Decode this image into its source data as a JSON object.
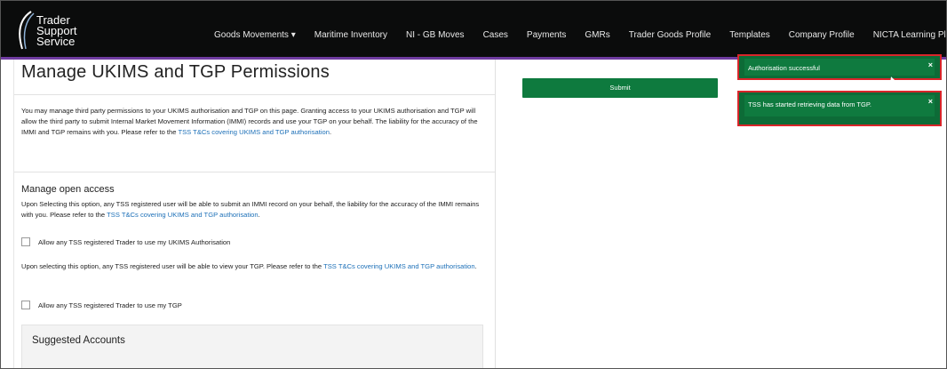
{
  "header": {
    "logo_line1": "Trader",
    "logo_line2": "Support",
    "logo_line3": "Service",
    "nav": [
      {
        "label": "Goods Movements ▾"
      },
      {
        "label": "Maritime Inventory"
      },
      {
        "label": "NI - GB Moves"
      },
      {
        "label": "Cases"
      },
      {
        "label": "Payments"
      },
      {
        "label": "GMRs"
      },
      {
        "label": "Trader Goods Profile"
      },
      {
        "label": "Templates"
      },
      {
        "label": "Company Profile"
      },
      {
        "label": "NICTA Learning Platf"
      }
    ]
  },
  "page": {
    "title": "Manage UKIMS and TGP Permissions",
    "intro": "You may manage third party permissions to your UKIMS authorisation and TGP on this page. Granting access to your UKIMS authorisation and TGP will allow the third party to submit Internal Market Movement Information (IMMI) records and use your TGP on your behalf. The liability for the accuracy of the IMMI and TGP remains with you. Please refer to the ",
    "intro_link": "TSS T&Cs covering UKIMS and TGP authorisation",
    "intro_end": ".",
    "open_access_heading": "Manage open access",
    "open_access_text": "Upon Selecting this option, any TSS registered user will be able to submit an IMMI record on your behalf, the liability for the accuracy of the IMMI remains with you. Please refer to the ",
    "open_access_link": "TSS T&Cs covering UKIMS and TGP authorisation",
    "open_access_end": ".",
    "checkbox_ukims": "Allow any TSS registered Trader to use my UKIMS Authorisation",
    "tgp_text": "Upon selecting this option, any TSS registered user will be able to view your TGP. Please refer to the ",
    "tgp_link": "TSS T&Cs covering UKIMS and TGP authorisation",
    "tgp_end": ".",
    "checkbox_tgp": "Allow any TSS registered Trader to use my TGP",
    "suggested_accounts": "Suggested Accounts",
    "submit_label": "Submit"
  },
  "toasts": [
    {
      "message": "Authorisation successful",
      "close": "×"
    },
    {
      "message": "TSS has started retrieving data from TGP.",
      "close": "×"
    }
  ],
  "colors": {
    "header_bg": "#0b0c0c",
    "accent": "#6f3ba0",
    "submit": "#0e7a3e",
    "toast": "#0f7a3f",
    "highlight": "#d9252a",
    "link": "#1d70b8"
  }
}
